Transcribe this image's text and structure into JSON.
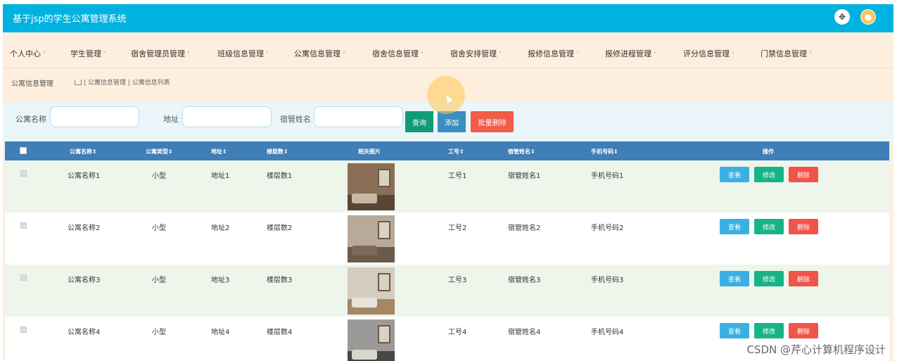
{
  "header": {
    "title": "基于jsp的学生公寓管理系统",
    "icons": [
      "fullscreen-icon",
      "user-avatar-icon"
    ]
  },
  "menu": [
    {
      "label": "个人中心",
      "caret": "˅"
    },
    {
      "label": "学生管理",
      "caret": "˅"
    },
    {
      "label": "宿舍管理员管理",
      "caret": "˅"
    },
    {
      "label": "班级信息管理",
      "caret": "˅"
    },
    {
      "label": "公寓信息管理",
      "caret": "˅"
    },
    {
      "label": "宿舍信息管理",
      "caret": "˅"
    },
    {
      "label": "宿舍安排管理",
      "caret": "˅"
    },
    {
      "label": "报修信息管理",
      "caret": "˅"
    },
    {
      "label": "报修进程管理",
      "caret": "˅"
    },
    {
      "label": "评分信息管理",
      "caret": "˅"
    },
    {
      "label": "门禁信息管理",
      "caret": "˅"
    }
  ],
  "breadcrumb": {
    "section": "公寓信息管理",
    "path": "| 公寓信息管理 | 公寓信息列表"
  },
  "search": {
    "fields": [
      {
        "label": "公寓名称",
        "value": "",
        "placeholder": ""
      },
      {
        "label": "地址",
        "value": "",
        "placeholder": ""
      },
      {
        "label": "宿管姓名",
        "value": "",
        "placeholder": ""
      }
    ],
    "search_label": "查询",
    "add_label": "添加",
    "batch_delete_label": "批量删除"
  },
  "table": {
    "columns": [
      "公寓名称",
      "公寓类型",
      "地址",
      "楼层数",
      "相关图片",
      "工号",
      "宿管姓名",
      "手机号码",
      "操作"
    ],
    "rows": [
      {
        "name": "公寓名称1",
        "type": "小型",
        "address": "地址1",
        "floors": "楼层数1",
        "worker_id": "工号1",
        "manager": "宿管姓名1",
        "phone": "手机号码1"
      },
      {
        "name": "公寓名称2",
        "type": "小型",
        "address": "地址2",
        "floors": "楼层数2",
        "worker_id": "工号2",
        "manager": "宿管姓名2",
        "phone": "手机号码2"
      },
      {
        "name": "公寓名称3",
        "type": "小型",
        "address": "地址3",
        "floors": "楼层数3",
        "worker_id": "工号3",
        "manager": "宿管姓名3",
        "phone": "手机号码3"
      },
      {
        "name": "公寓名称4",
        "type": "小型",
        "address": "地址4",
        "floors": "楼层数4",
        "worker_id": "工号4",
        "manager": "宿管姓名4",
        "phone": "手机号码4"
      }
    ],
    "actions": {
      "view": "查看",
      "edit": "修改",
      "delete": "删除"
    }
  },
  "watermark": "CSDN @芹心计算机程序设计",
  "colors": {
    "topbar": "#00b2df",
    "menu_bg": "#fdeedd",
    "table_header": "#3f7eb6",
    "view": "#3ab0e2",
    "edit": "#17b487",
    "delete": "#f0544a"
  }
}
